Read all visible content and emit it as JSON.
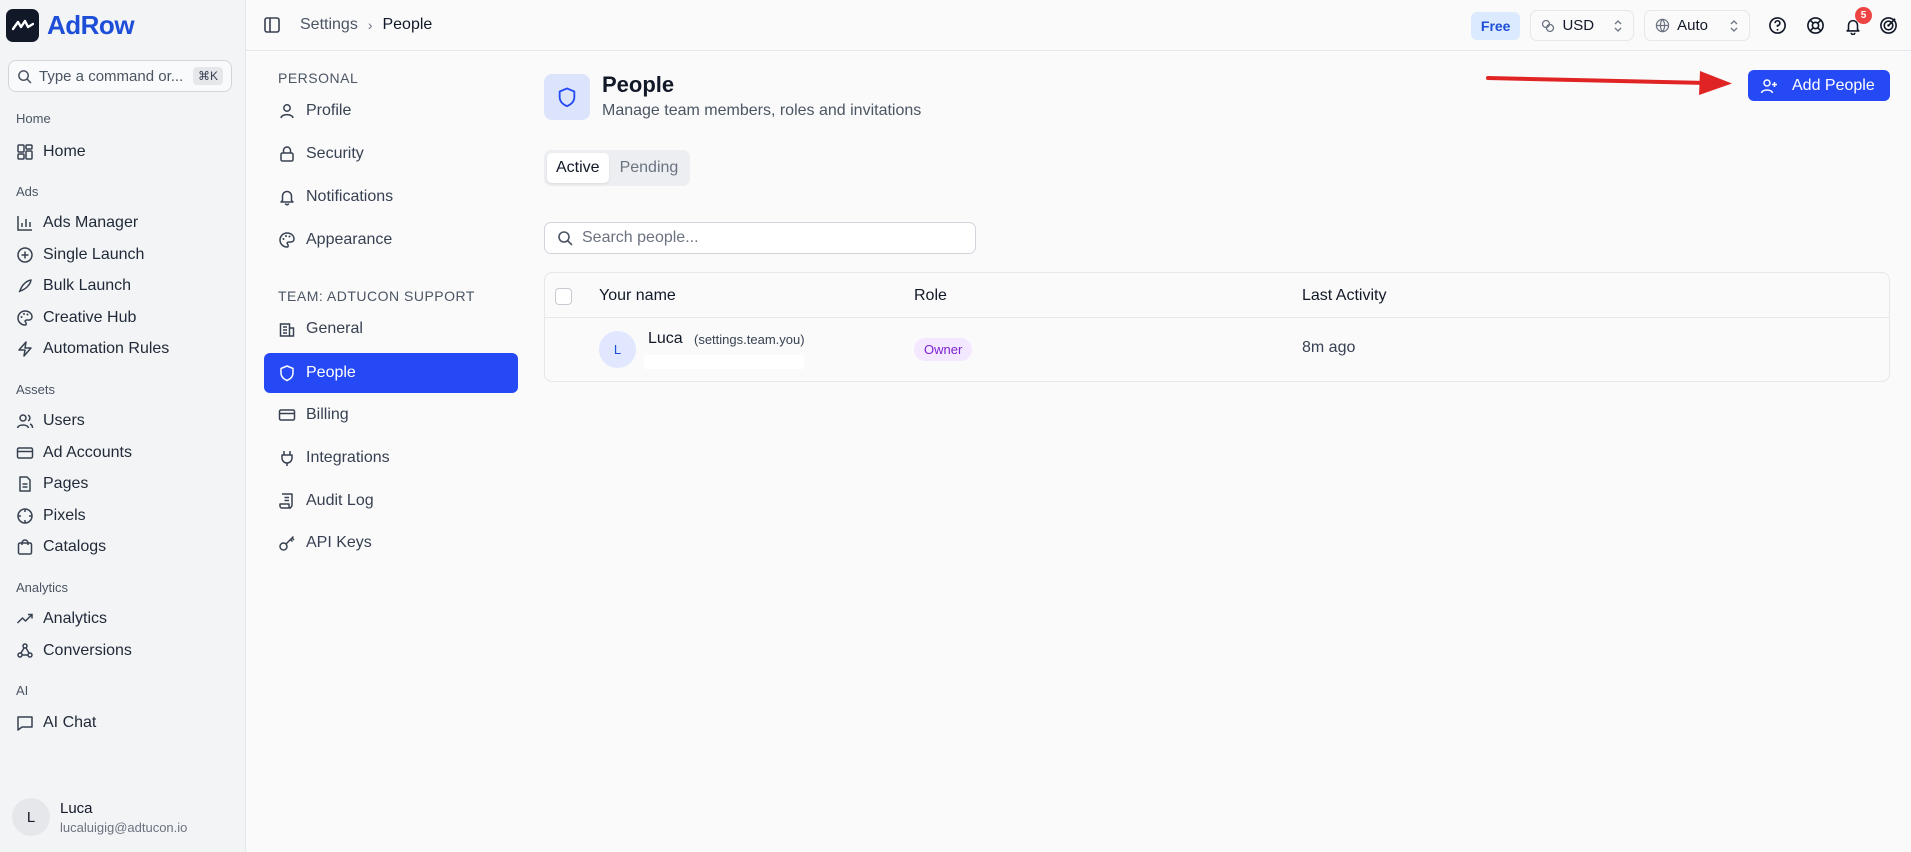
{
  "brand": {
    "name": "AdRow"
  },
  "command": {
    "placeholder": "Type a command or...",
    "shortcut": "⌘K"
  },
  "sidebar": {
    "sections": [
      "Home",
      "Ads",
      "Assets",
      "Analytics",
      "AI"
    ],
    "items": [
      {
        "label": "Home",
        "icon": "dashboard-icon"
      },
      {
        "label": "Ads Manager",
        "icon": "bar-chart-icon"
      },
      {
        "label": "Single Launch",
        "icon": "plus-circle-icon"
      },
      {
        "label": "Bulk Launch",
        "icon": "rocket-icon"
      },
      {
        "label": "Creative Hub",
        "icon": "palette-icon"
      },
      {
        "label": "Automation Rules",
        "icon": "bolt-icon"
      },
      {
        "label": "Users",
        "icon": "users-icon"
      },
      {
        "label": "Ad Accounts",
        "icon": "card-icon"
      },
      {
        "label": "Pages",
        "icon": "document-icon"
      },
      {
        "label": "Pixels",
        "icon": "crosshair-icon"
      },
      {
        "label": "Catalogs",
        "icon": "shopping-bag-icon"
      },
      {
        "label": "Analytics",
        "icon": "trend-icon"
      },
      {
        "label": "Conversions",
        "icon": "webhook-icon"
      },
      {
        "label": "AI Chat",
        "icon": "chat-icon"
      }
    ]
  },
  "user": {
    "initial": "L",
    "name": "Luca",
    "email": "lucaluigig@adtucon.io"
  },
  "breadcrumb": {
    "parent": "Settings",
    "current": "People"
  },
  "topbar": {
    "plan": "Free",
    "currency": "USD",
    "theme": "Auto",
    "notifications": "5"
  },
  "settings_nav": {
    "personal_label": "PERSONAL",
    "team_label": "TEAM: ADTUCON SUPPORT",
    "personal": [
      "Profile",
      "Security",
      "Notifications",
      "Appearance"
    ],
    "team": [
      "General",
      "People",
      "Billing",
      "Integrations",
      "Audit Log",
      "API Keys"
    ]
  },
  "page": {
    "title": "People",
    "subtitle": "Manage team members, roles and invitations",
    "add_button": "Add People",
    "tabs": [
      "Active",
      "Pending"
    ],
    "search_placeholder": "Search people..."
  },
  "table": {
    "columns": [
      "Your name",
      "Role",
      "Last Activity"
    ],
    "rows": [
      {
        "initial": "L",
        "name": "Luca",
        "you_label": "(settings.team.you)",
        "role": "Owner",
        "last_activity": "8m ago"
      }
    ]
  },
  "colors": {
    "primary": "#2449f5",
    "brand": "#1d4ed8",
    "annotation_arrow": "#e02424"
  }
}
